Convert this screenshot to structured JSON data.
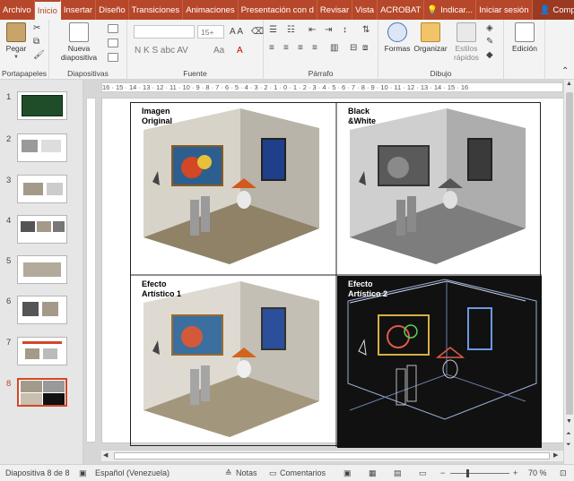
{
  "tabs": [
    {
      "label": "Archivo",
      "active": false
    },
    {
      "label": "Inicio",
      "active": true
    },
    {
      "label": "Insertar",
      "active": false
    },
    {
      "label": "Diseño",
      "active": false
    },
    {
      "label": "Transiciones",
      "active": false
    },
    {
      "label": "Animaciones",
      "active": false
    },
    {
      "label": "Presentación con d",
      "active": false
    },
    {
      "label": "Revisar",
      "active": false
    },
    {
      "label": "Vista",
      "active": false
    },
    {
      "label": "ACROBAT",
      "active": false
    },
    {
      "label": "Indicar...",
      "active": false
    }
  ],
  "account": {
    "signin": "Iniciar sesión",
    "share": "Compartir"
  },
  "ribbon": {
    "clipboard": {
      "label": "Portapapeles",
      "paste": "Pegar"
    },
    "slides": {
      "label": "Diapositivas",
      "new_slide": "Nueva",
      "new_slide_2": "diapositiva"
    },
    "font": {
      "label": "Fuente",
      "size": "15+",
      "format_letters": "N  K  S  abc  AV",
      "grow_shrink": "A  A"
    },
    "paragraph": {
      "label": "Párrafo"
    },
    "drawing": {
      "label": "Dibujo",
      "shapes": "Formas",
      "arrange": "Organizar",
      "quick_styles": "Estilos",
      "quick_styles_2": "rápidos"
    },
    "editing": {
      "label": "Edición"
    }
  },
  "ruler": {
    "h_ticks": "16 · 15 · 14 · 13 · 12 · 11 · 10 · 9 · 8 · 7 · 6 · 5 · 4 · 3 · 2 · 1 · 0 · 1 · 2 · 3 · 4 · 5 · 6 · 7 · 8 · 9 · 10 · 11 · 12 · 13 · 14 · 15 · 16"
  },
  "thumbnails": [
    {
      "num": "1",
      "active": false
    },
    {
      "num": "2",
      "active": false
    },
    {
      "num": "3",
      "active": false
    },
    {
      "num": "4",
      "active": false
    },
    {
      "num": "5",
      "active": false
    },
    {
      "num": "6",
      "active": false
    },
    {
      "num": "7",
      "active": false
    },
    {
      "num": "8",
      "active": true
    }
  ],
  "slide": {
    "cells": [
      {
        "label": "Imagen\nOriginal",
        "label_color": "#000000",
        "bg": "#ffffff"
      },
      {
        "label": "Black\n&White",
        "label_color": "#000000",
        "bg": "#ffffff"
      },
      {
        "label": "Efecto\nArtístico 1",
        "label_color": "#000000",
        "bg": "#ffffff"
      },
      {
        "label": "Efecto\nArtístico 2",
        "label_color": "#ffffff",
        "bg": "#111111"
      }
    ]
  },
  "status": {
    "slide_info": "Diapositiva 8 de 8",
    "language": "Español (Venezuela)",
    "notes": "Notas",
    "comments": "Comentarios",
    "zoom": "70 %"
  },
  "colors": {
    "accent": "#b7472a",
    "selected_thumb": "#d24726"
  }
}
